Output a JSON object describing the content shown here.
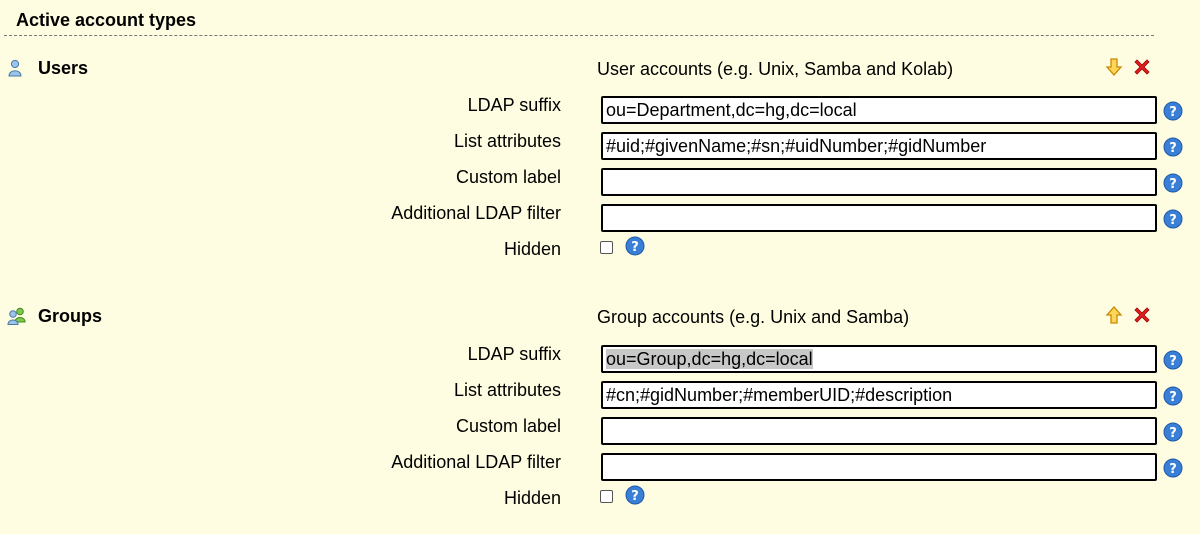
{
  "section": {
    "title": "Active account types"
  },
  "account_types": [
    {
      "name": "Users",
      "description": "User accounts (e.g. Unix, Samba and Kolab)",
      "icon": "user-icon",
      "move_direction": "down",
      "fields": {
        "ldap_suffix": {
          "label": "LDAP suffix",
          "value": "ou=Department,dc=hg,dc=local"
        },
        "list_attributes": {
          "label": "List attributes",
          "value": "#uid;#givenName;#sn;#uidNumber;#gidNumber"
        },
        "custom_label": {
          "label": "Custom label",
          "value": ""
        },
        "additional_filter": {
          "label": "Additional LDAP filter",
          "value": ""
        },
        "hidden": {
          "label": "Hidden",
          "checked": false
        }
      }
    },
    {
      "name": "Groups",
      "description": "Group accounts (e.g. Unix and Samba)",
      "icon": "group-icon",
      "move_direction": "up",
      "fields": {
        "ldap_suffix": {
          "label": "LDAP suffix",
          "value": "ou=Group,dc=hg,dc=local"
        },
        "list_attributes": {
          "label": "List attributes",
          "value": "#cn;#gidNumber;#memberUID;#description"
        },
        "custom_label": {
          "label": "Custom label",
          "value": ""
        },
        "additional_filter": {
          "label": "Additional LDAP filter",
          "value": ""
        },
        "hidden": {
          "label": "Hidden",
          "checked": false
        }
      }
    }
  ],
  "colors": {
    "background": "#fffde1",
    "help_blue": "#3a7fd6",
    "delete_red": "#e02020",
    "arrow_orange": "#e8a000"
  }
}
